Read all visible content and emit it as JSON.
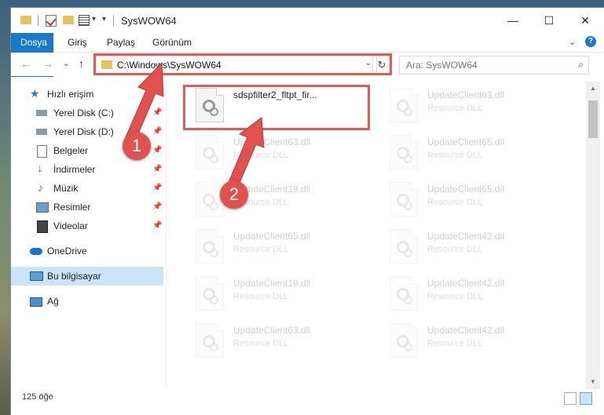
{
  "window": {
    "title": "SysWOW64",
    "controls": {
      "minimize": "—",
      "maximize": "☐",
      "close": "✕"
    }
  },
  "ribbon": {
    "tabs": [
      "Dosya",
      "Giriş",
      "Paylaş",
      "Görünüm"
    ],
    "expand_icon": "chevron-down",
    "help_icon": "?"
  },
  "nav": {
    "back": "←",
    "forward": "→",
    "recent": "⌄",
    "up": "↑"
  },
  "address": {
    "path": "C:\\Windows\\SysWOW64",
    "dropdown": "⌄",
    "refresh": "↻"
  },
  "search": {
    "placeholder": "Ara: SysWOW64",
    "icon": "🔍"
  },
  "sidebar": {
    "items": [
      {
        "label": "Hızlı erişim",
        "icon": "star-icon",
        "pinned": false
      },
      {
        "label": "Yerel Disk (C:)",
        "icon": "drive-icon",
        "pinned": true
      },
      {
        "label": "Yerel Disk (D:)",
        "icon": "drive-icon",
        "pinned": true
      },
      {
        "label": "Belgeler",
        "icon": "documents-icon",
        "pinned": true
      },
      {
        "label": "İndirmeler",
        "icon": "download-icon",
        "pinned": true
      },
      {
        "label": "Müzik",
        "icon": "music-icon",
        "pinned": true
      },
      {
        "label": "Resimler",
        "icon": "pictures-icon",
        "pinned": true
      },
      {
        "label": "Videolar",
        "icon": "videos-icon",
        "pinned": true
      },
      {
        "label": "OneDrive",
        "icon": "cloud-icon",
        "pinned": false
      },
      {
        "label": "Bu bilgisayar",
        "icon": "computer-icon",
        "pinned": false
      },
      {
        "label": "Ağ",
        "icon": "network-icon",
        "pinned": false
      }
    ],
    "selected": "Bu bilgisayar"
  },
  "files": {
    "left": [
      {
        "name": "sdspfilter2_fltpt_fir...",
        "type": "",
        "highlighted": true
      },
      {
        "name": "UpdateClient63.dll",
        "type": "Resource DLL"
      },
      {
        "name": "UpdateClient19.dll",
        "type": "Resource DLL"
      },
      {
        "name": "UpdateClient65.dll",
        "type": "Resource DLL"
      },
      {
        "name": "UpdateClient19.dll",
        "type": "Resource DLL"
      },
      {
        "name": "UpdateClient63.dll",
        "type": "Resource DLL"
      }
    ],
    "right": [
      {
        "name": "UpdateClient63.dll",
        "type": "Resource DLL"
      },
      {
        "name": "UpdateClient65.dll",
        "type": "Resource DLL"
      },
      {
        "name": "UpdateClient65.dll",
        "type": "Resource DLL"
      },
      {
        "name": "UpdateClient42.dll",
        "type": "Resource DLL"
      },
      {
        "name": "UpdateClient42.dll",
        "type": "Resource DLL"
      },
      {
        "name": "UpdateClient42.dll",
        "type": "Resource DLL"
      }
    ]
  },
  "status": {
    "count": "125 öğe"
  },
  "annotations": {
    "step1": "1",
    "step2": "2",
    "highlight_color": "#e05a5a"
  }
}
